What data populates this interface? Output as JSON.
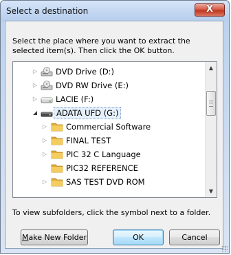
{
  "window": {
    "title": "Select a destination",
    "close_glyph": "X"
  },
  "instruction": "Select the place where you want to extract the selected item(s).  Then click the OK button.",
  "tree": {
    "items": [
      {
        "label": "DVD Drive (D:)",
        "icon": "dvd-drive-icon",
        "expander": "collapsed"
      },
      {
        "label": "DVD RW Drive (E:)",
        "icon": "dvd-rw-drive-icon",
        "expander": "collapsed"
      },
      {
        "label": "LACIE (F:)",
        "icon": "removable-drive-icon",
        "expander": "collapsed"
      },
      {
        "label": "ADATA UFD (G:)",
        "icon": "usb-drive-icon",
        "expander": "expanded",
        "selected": true
      },
      {
        "label": "Commercial Software",
        "icon": "folder-icon",
        "expander": "collapsed"
      },
      {
        "label": "FINAL TEST",
        "icon": "folder-icon",
        "expander": "collapsed"
      },
      {
        "label": "PIC 32 C Language",
        "icon": "folder-icon",
        "expander": "collapsed"
      },
      {
        "label": "PIC32 REFERENCE",
        "icon": "folder-icon",
        "expander": "none"
      },
      {
        "label": "SAS TEST DVD ROM",
        "icon": "folder-icon",
        "expander": "collapsed"
      }
    ],
    "scroll_up_glyph": "▲",
    "scroll_down_glyph": "▼"
  },
  "hint": "To view subfolders, click the symbol next to a folder.",
  "buttons": {
    "make_new_folder_accel": "M",
    "make_new_folder_rest": "ake New Folder",
    "ok": "OK",
    "cancel": "Cancel"
  },
  "colors": {
    "titlebar": "#c1d6f1",
    "close_button": "#c1371f",
    "selection_border": "#7aa0cf",
    "folder": "#f0c24a"
  }
}
